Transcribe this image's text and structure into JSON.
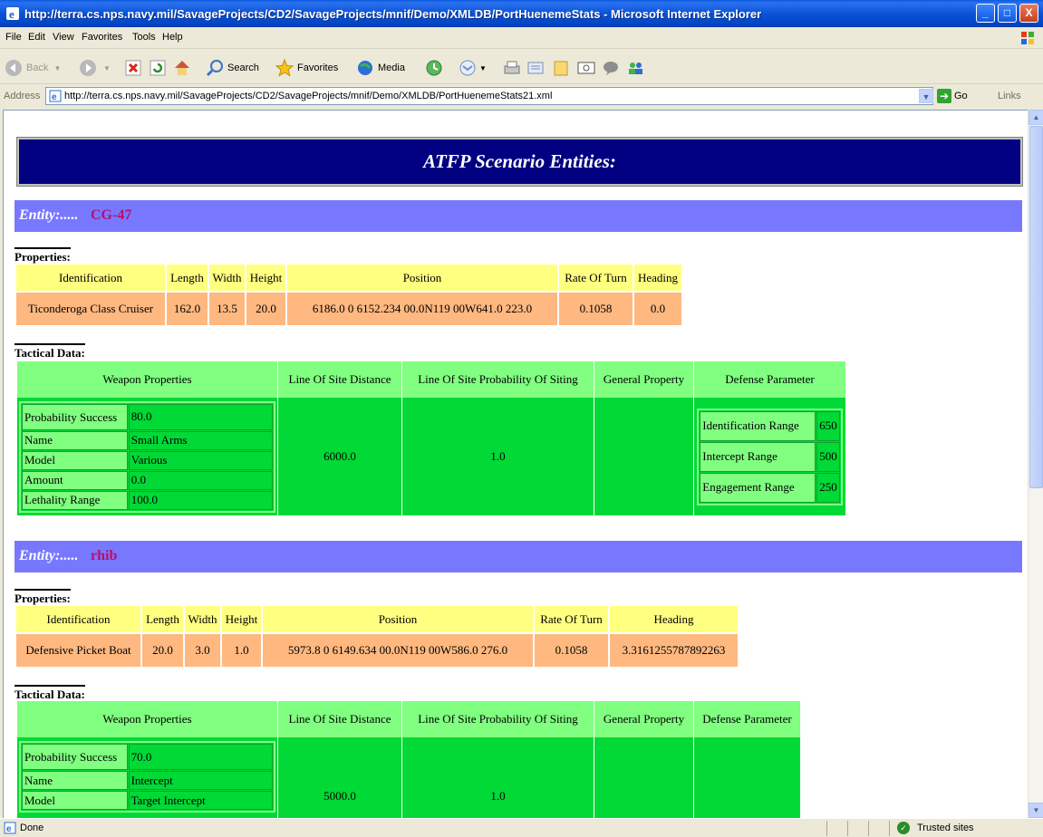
{
  "window": {
    "title": "http://terra.cs.nps.navy.mil/SavageProjects/CD2/SavageProjects/mnif/Demo/XMLDB/PortHuenemeStats - Microsoft Internet Explorer"
  },
  "menu": [
    "File",
    "Edit",
    "View",
    "Favorites",
    "Tools",
    "Help"
  ],
  "toolbar": {
    "back": "Back",
    "search": "Search",
    "favorites": "Favorites",
    "media": "Media"
  },
  "address": {
    "label": "Address",
    "url": "http://terra.cs.nps.navy.mil/SavageProjects/CD2/SavageProjects/mnif/Demo/XMLDB/PortHuenemeStats21.xml",
    "go": "Go",
    "links": "Links"
  },
  "status": {
    "text": "Done",
    "zone": "Trusted sites"
  },
  "page": {
    "banner": "ATFP Scenario Entities:",
    "entity_lead": "Entity:.....",
    "properties_label": "Properties:",
    "tactical_label": "Tactical Data:",
    "prop_headers": [
      "Identification",
      "Length",
      "Width",
      "Height",
      "Position",
      "Rate Of Turn",
      "Heading"
    ],
    "tactical_headers": [
      "Weapon Properties",
      "Line Of Site Distance",
      "Line Of Site Probability Of Siting",
      "General Property",
      "Defense Parameter"
    ],
    "weapon_keys": [
      "Probability Success",
      "Name",
      "Model",
      "Amount",
      "Lethality Range"
    ],
    "entities": [
      {
        "name": "CG-47",
        "props": [
          "Ticonderoga Class Cruiser",
          "162.0",
          "13.5",
          "20.0",
          "6186.0 0 6152.234 00.0N119 00W641.0 223.0",
          "0.1058",
          "0.0"
        ],
        "weapon_values": [
          "80.0",
          "Small Arms",
          "Various",
          "0.0",
          "100.0"
        ],
        "los_distance": "6000.0",
        "los_probability": "1.0",
        "defense": [
          {
            "k": "Identification Range",
            "v": "650"
          },
          {
            "k": "Intercept Range",
            "v": "500"
          },
          {
            "k": "Engagement Range",
            "v": "250"
          }
        ]
      },
      {
        "name": "rhib",
        "props": [
          "Defensive Picket Boat",
          "20.0",
          "3.0",
          "1.0",
          "5973.8 0 6149.634 00.0N119 00W586.0 276.0",
          "0.1058",
          "3.3161255787892263"
        ],
        "weapon_values": [
          "70.0",
          "Intercept",
          "Target Intercept"
        ],
        "los_distance": "5000.0",
        "los_probability": "1.0"
      }
    ]
  }
}
